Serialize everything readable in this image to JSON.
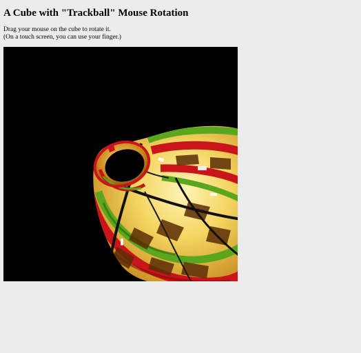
{
  "page": {
    "title": "A Cube with \"Trackball\" Mouse Rotation",
    "instructions": {
      "line1": "Drag your mouse on the cube to rotate it.",
      "line2": "(On a touch screen, you can use your finger.)"
    }
  },
  "canvas": {
    "background_color": "#000000",
    "object_palette": [
      "#f2d35a",
      "#c8141a",
      "#5aa61e",
      "#8a4a0f",
      "#1a1a1a"
    ]
  }
}
